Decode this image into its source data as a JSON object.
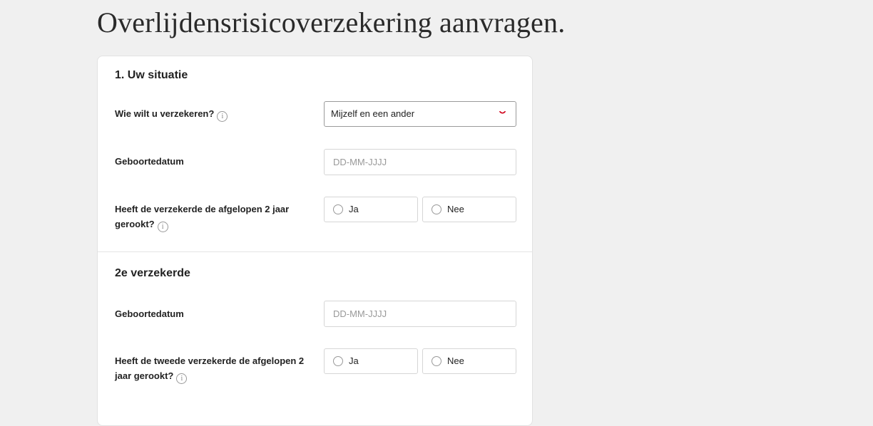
{
  "page": {
    "title": "Overlijdensrisicoverzekering aanvragen."
  },
  "section1": {
    "title": "1. Uw situatie",
    "who": {
      "label": "Wie wilt u verzekeren?",
      "value": "Mijzelf en een ander"
    },
    "birthdate": {
      "label": "Geboortedatum",
      "placeholder": "DD-MM-JJJJ"
    },
    "smoked": {
      "label": "Heeft de verzekerde de afgelopen 2 jaar gerookt?",
      "yes": "Ja",
      "no": "Nee"
    }
  },
  "section2": {
    "title": "2e verzekerde",
    "birthdate": {
      "label": "Geboortedatum",
      "placeholder": "DD-MM-JJJJ"
    },
    "smoked": {
      "label": "Heeft de tweede verzekerde de afgelopen 2 jaar gerookt?",
      "yes": "Ja",
      "no": "Nee"
    }
  },
  "icons": {
    "info": "i"
  },
  "colors": {
    "accent": "#d0021b",
    "background": "#f0f0f0",
    "card": "#ffffff"
  }
}
